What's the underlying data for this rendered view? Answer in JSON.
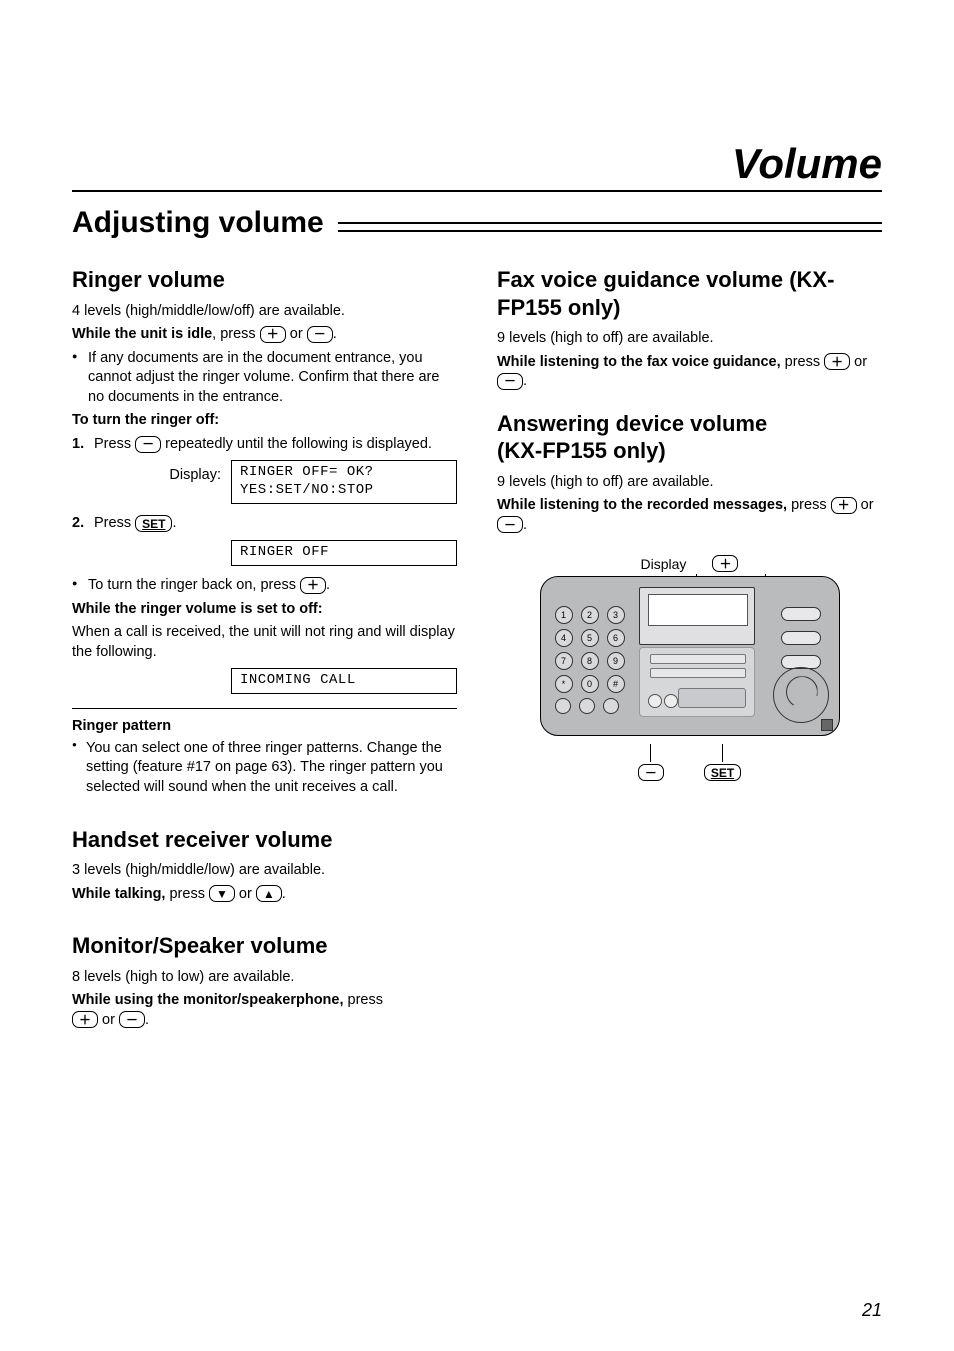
{
  "doc_title": "Volume",
  "section_heading": "Adjusting volume",
  "page_number": "21",
  "left": {
    "ringer": {
      "heading": "Ringer volume",
      "intro": "4 levels (high/middle/low/off) are available.",
      "while_label": "While the unit is idle",
      "while_suffix": ", press ",
      "or": " or ",
      "period": ".",
      "bullet1": "If any documents are in the document entrance, you cannot adjust the ringer volume. Confirm that there are no documents in the entrance.",
      "turn_off_heading": "To turn the ringer off:",
      "step1_a": "Press ",
      "step1_b": " repeatedly until the following is displayed.",
      "display_label": "Display:",
      "lcd1_l1": "RINGER OFF= OK?",
      "lcd1_l2": "YES:SET/NO:STOP",
      "step2_a": "Press ",
      "step2_set": "SET",
      "step2_b": ".",
      "lcd2": "RINGER OFF",
      "back_on_a": "To turn the ringer back on, press ",
      "back_on_b": ".",
      "while_off_heading": "While the ringer volume is set to off:",
      "while_off_text": "When a call is received, the unit will not ring and will display the following.",
      "lcd3": "INCOMING CALL",
      "pattern_heading": "Ringer pattern",
      "pattern_note": "You can select one of three ringer patterns. Change the setting (feature #17 on page 63). The ringer pattern you selected will sound when the unit receives a call."
    },
    "handset": {
      "heading": "Handset receiver volume",
      "intro": "3 levels (high/middle/low) are available.",
      "while_label": "While talking,",
      "while_suffix": " press "
    },
    "monitor": {
      "heading": "Monitor/Speaker volume",
      "intro": "8 levels (high to low) are available.",
      "while_label": "While using the monitor/speakerphone,",
      "while_suffix": " press"
    }
  },
  "right": {
    "fax_guidance": {
      "heading": "Fax voice guidance volume (KX-FP155 only)",
      "intro": "9 levels (high to off) are available.",
      "while_label": "While listening to the fax voice guidance,",
      "while_suffix": " press "
    },
    "answering": {
      "heading_l1": "Answering device volume",
      "heading_l2": "(KX-FP155 only)",
      "intro": "9 levels (high to off) are available.",
      "while_label": "While listening to the recorded messages,",
      "while_suffix": " press "
    },
    "diagram": {
      "display_label": "Display",
      "plus_label": "＋",
      "minus_label": "－",
      "set_label": "SET",
      "keys": [
        "1",
        "2",
        "3",
        "4",
        "5",
        "6",
        "7",
        "8",
        "9",
        "*",
        "0",
        "#"
      ]
    }
  },
  "icons": {
    "plus": "＋",
    "minus": "－",
    "down": "▼",
    "up": "▲"
  }
}
